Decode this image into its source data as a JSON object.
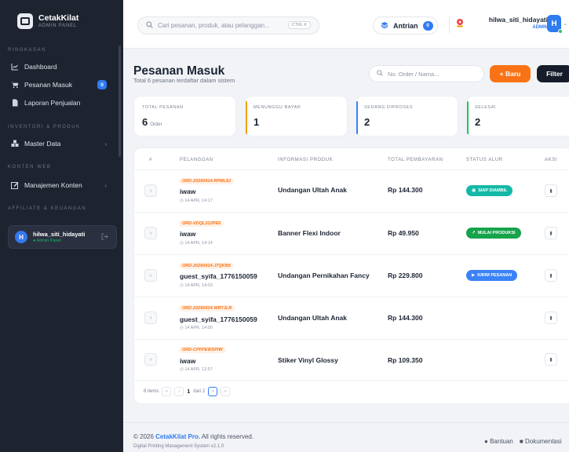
{
  "brand": {
    "name": "CetakKilat",
    "subtitle": "ADMIN PANEL"
  },
  "sidebar": {
    "sections": [
      {
        "title": "RINGKASAN"
      },
      {
        "title": "INVENTORI & PRODUK"
      },
      {
        "title": "KONTEN WEB"
      },
      {
        "title": "AFFILIATE & KEUANGAN"
      }
    ],
    "items": [
      {
        "label": "Dashboard",
        "icon": "chart-line-icon"
      },
      {
        "label": "Pesanan Masuk",
        "icon": "cart-icon",
        "badge": "0"
      },
      {
        "label": "Laporan Penjualan",
        "icon": "file-icon"
      },
      {
        "label": "Master Data",
        "icon": "boxes-icon"
      },
      {
        "label": "Manajemen Konten",
        "icon": "edit-icon"
      }
    ],
    "user": {
      "initial": "H",
      "name": "hilwa_siti_hidayati",
      "role": "● Admin Panel"
    }
  },
  "topbar": {
    "search_placeholder": "Cari pesanan, produk, atau pelanggan...",
    "search_shortcut": "CTRL K",
    "queue_label": "Antrian",
    "queue_count": "0",
    "user_name": "hilwa_siti_hidayati",
    "user_role": "ADMIN",
    "user_initial": "H"
  },
  "page": {
    "title": "Pesanan Masuk",
    "subtitle": "Total 6 pesanan terdaftar dalam sistem",
    "order_search_placeholder": "No. Order / Nama...",
    "new_button": "+ Baru",
    "filter_button": "Filter"
  },
  "stats": [
    {
      "label": "TOTAL PESANAN",
      "value": "6",
      "unit": "Order",
      "color": "#ffffff"
    },
    {
      "label": "MENUNGGU BAYAR",
      "value": "1",
      "unit": "",
      "color": "#f59e0b"
    },
    {
      "label": "SEDANG DIPROSES",
      "value": "2",
      "unit": "",
      "color": "#3b82f6"
    },
    {
      "label": "SELESAI",
      "value": "2",
      "unit": "",
      "color": "#22c55e"
    }
  ],
  "table": {
    "headers": [
      "#",
      "PELANGGAN",
      "INFORMASI PRODUK",
      "TOTAL PEMBAYARAN",
      "STATUS ALUR",
      "AKSI"
    ],
    "rows": [
      {
        "order_id": "ORD-20260414-RPML9J",
        "customer": "iwaw",
        "time": "◷ 14 APR, 14:17",
        "product": "Undangan Ultah Anak",
        "total": "Rp 144.300",
        "status": "SIAP DIAMBIL",
        "status_color": "#14b8a6"
      },
      {
        "order_id": "ORD-VDQL31ZPE0",
        "customer": "iwaw",
        "time": "◷ 14 APR, 14:14",
        "product": "Banner Flexi Indoor",
        "total": "Rp 49.950",
        "status": "MULAI PRODUKSI",
        "status_color": "#16a34a"
      },
      {
        "order_id": "ORD-20260414-J7QKB6",
        "customer": "guest_syifa_1776150059",
        "time": "◷ 14 APR, 14:03",
        "product": "Undangan Pernikahan Fancy",
        "total": "Rp 229.800",
        "status": "KIRIM PESANAN",
        "status_color": "#3b82f6"
      },
      {
        "order_id": "ORD-20260414-WRTJLR",
        "customer": "guest_syifa_1776150059",
        "time": "◷ 14 APR, 14:00",
        "product": "Undangan Ultah Anak",
        "total": "Rp 144.300",
        "status": "",
        "status_color": ""
      },
      {
        "order_id": "ORD-CPFPEWSPIW",
        "customer": "iwaw",
        "time": "◷ 14 APR, 12:57",
        "product": "Stiker Vinyl Glossy",
        "total": "Rp 109.350",
        "status": "",
        "status_color": ""
      }
    ]
  },
  "pagination": {
    "items_label": "6 items",
    "current": "1",
    "of_label": "dari 2"
  },
  "footer": {
    "copy_prefix": "© 2026 ",
    "copy_brand": "CetakKilat Pro.",
    "copy_suffix": " All rights reserved.",
    "sub": "Digital Printing Management System v2.1.0",
    "help": "Bantuan",
    "docs": "Dokumentasi"
  }
}
